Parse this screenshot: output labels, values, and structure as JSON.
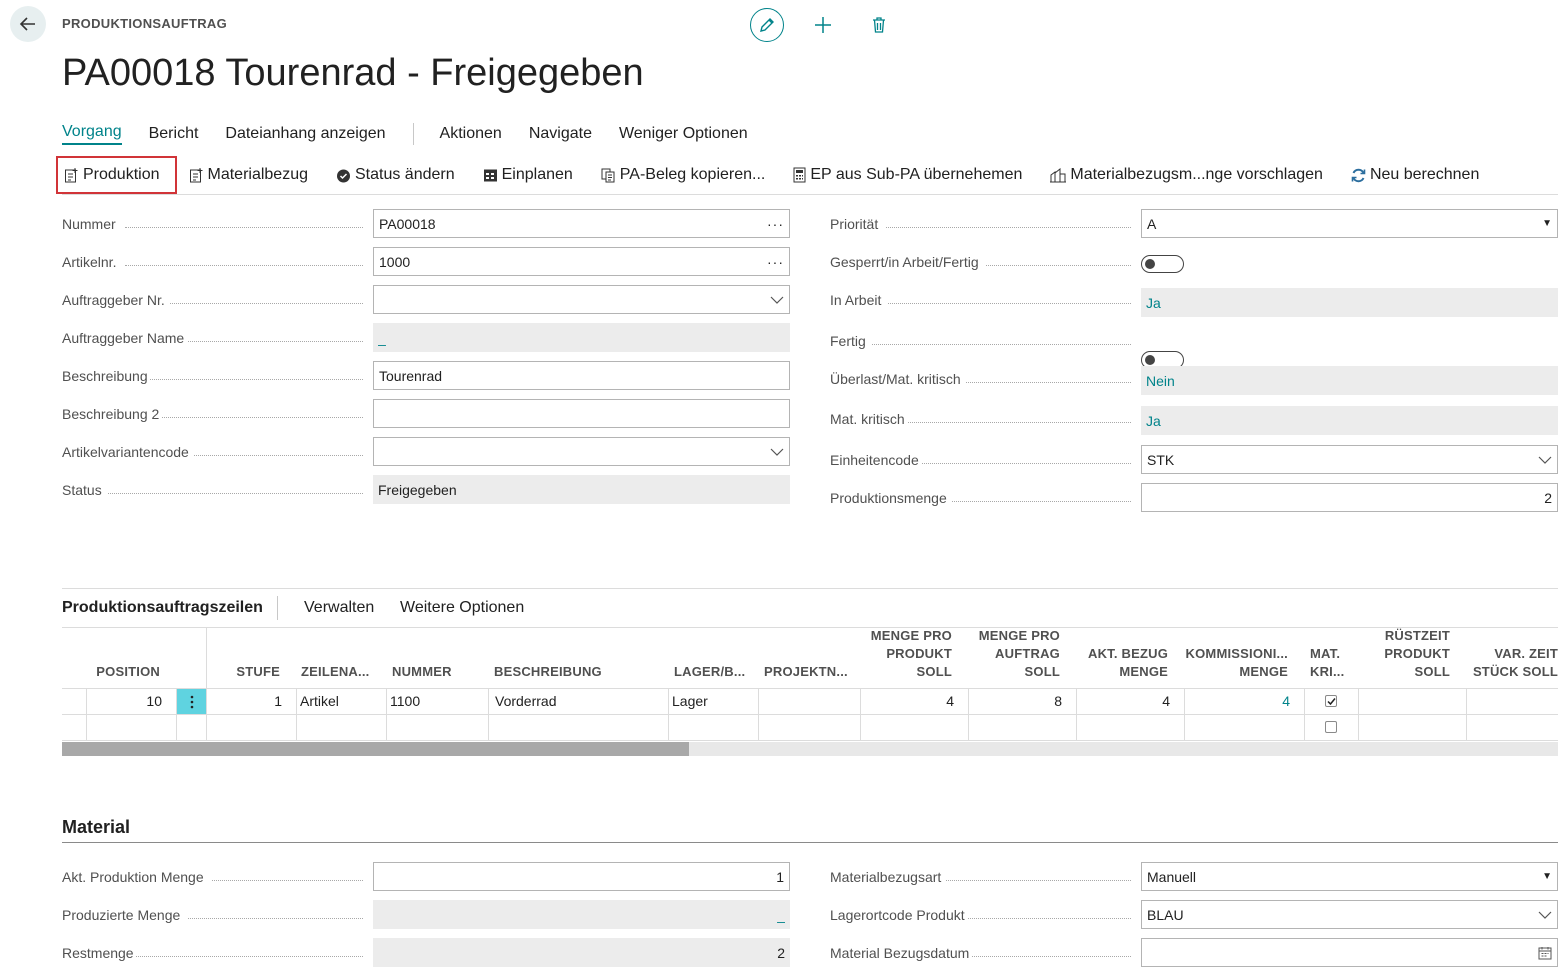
{
  "header": {
    "kicker": "PRODUKTIONSAUFTRAG",
    "title": "PA00018 Tourenrad - Freigegeben",
    "icons": [
      "back-arrow-icon",
      "pencil-icon",
      "plus-icon",
      "trash-icon"
    ]
  },
  "menu": {
    "items": [
      "Vorgang",
      "Bericht",
      "Dateianhang anzeigen"
    ],
    "items2": [
      "Aktionen",
      "Navigate",
      "Weniger Optionen"
    ]
  },
  "actions": [
    {
      "label": "Produktion",
      "icon": "production-icon"
    },
    {
      "label": "Materialbezug",
      "icon": "material-icon"
    },
    {
      "label": "Status ändern",
      "icon": "status-icon"
    },
    {
      "label": "Einplanen",
      "icon": "schedule-icon"
    },
    {
      "label": "PA-Beleg kopieren...",
      "icon": "copy-icon"
    },
    {
      "label": "EP aus Sub-PA übernehemen",
      "icon": "calculator-icon"
    },
    {
      "label": "Materialbezugsm...nge vorschlagen",
      "icon": "suggest-icon"
    },
    {
      "label": "Neu berechnen",
      "icon": "refresh-icon"
    }
  ],
  "general_left": [
    {
      "label": "Nummer",
      "value": "PA00018"
    },
    {
      "label": "Artikelnr.",
      "value": "1000"
    },
    {
      "label": "Auftraggeber Nr.",
      "value": ""
    },
    {
      "label": "Auftraggeber Name",
      "value": "_"
    },
    {
      "label": "Beschreibung",
      "value": "Tourenrad"
    },
    {
      "label": "Beschreibung 2",
      "value": ""
    },
    {
      "label": "Artikelvariantencode",
      "value": ""
    },
    {
      "label": "Status",
      "value": "Freigegeben"
    }
  ],
  "general_right": [
    {
      "label": "Priorität",
      "value": "A"
    },
    {
      "label": "Gesperrt/in Arbeit/Fertig",
      "value": ""
    },
    {
      "label": "In Arbeit",
      "value": "Ja"
    },
    {
      "label": "Fertig",
      "value": ""
    },
    {
      "label": "Überlast/Mat. kritisch",
      "value": "Nein"
    },
    {
      "label": "Mat. kritisch",
      "value": "Ja"
    },
    {
      "label": "Einheitencode",
      "value": "STK"
    },
    {
      "label": "Produktionsmenge",
      "value": "2"
    }
  ],
  "lines": {
    "title": "Produktionsauftragszeilen",
    "menu": [
      "Verwalten",
      "Weitere Optionen"
    ],
    "columns": [
      "POSITION",
      "STUFE",
      "ZEILENA...",
      "NUMMER",
      "BESCHREIBUNG",
      "LAGER/B...",
      "PROJEKTN...",
      "MENGE PRO\nPRODUKT\nSOLL",
      "MENGE PRO\nAUFTRAG\nSOLL",
      "AKT. BEZUG\nMENGE",
      "KOMMISSIONI...\nMENGE",
      "MAT.\nKRI...",
      "RÜSTZEIT\nPRODUKT\nSOLL",
      "VAR. ZEIT\nSTÜCK SOLL"
    ],
    "row": {
      "position": "10",
      "stufe": "1",
      "zeilenart": "Artikel",
      "nummer": "1100",
      "beschreibung": "Vorderrad",
      "lager": "Lager",
      "projekt": "",
      "menge_produkt": "4",
      "menge_auftrag": "8",
      "akt_bezug": "4",
      "kommission": "4"
    },
    "row_menu_icon": "ellipsis-vertical-icon"
  },
  "material": {
    "title": "Material",
    "left": [
      {
        "label": "Akt. Produktion Menge",
        "value": "1"
      },
      {
        "label": "Produzierte Menge",
        "value": "_"
      },
      {
        "label": "Restmenge",
        "value": "2"
      }
    ],
    "right": [
      {
        "label": "Materialbezugsart",
        "value": "Manuell"
      },
      {
        "label": "Lagerortcode Produkt",
        "value": "BLAU"
      },
      {
        "label": "Material Bezugsdatum",
        "value": ""
      }
    ]
  },
  "colors": {
    "accent": "#00838a",
    "highlight": "#d13438",
    "selected_cell": "#5fd3e0"
  }
}
